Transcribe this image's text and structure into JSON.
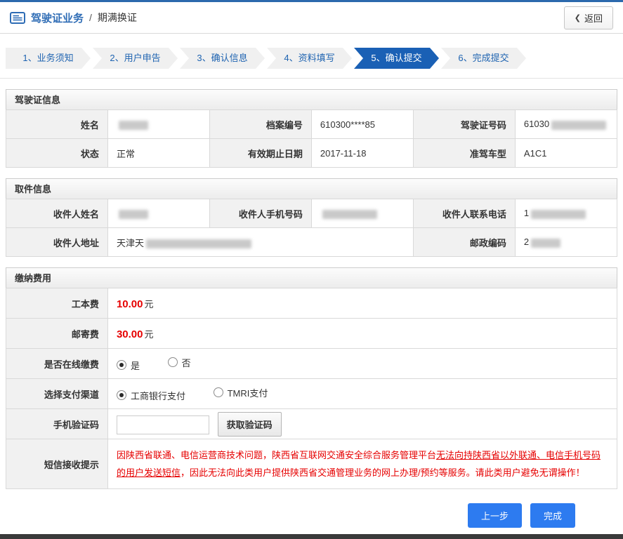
{
  "colors": {
    "accent_blue": "#2e6cb5",
    "active_step_blue": "#1a60b5",
    "alert_red": "#e60000",
    "button_blue": "#2d7bf0"
  },
  "header": {
    "title": "驾驶证业务",
    "separator": "/",
    "subtitle": "期满换证",
    "back_label": "返回"
  },
  "icons": {
    "back_chevron": "❮"
  },
  "steps": [
    {
      "label": "1、业务须知",
      "active": false
    },
    {
      "label": "2、用户申告",
      "active": false
    },
    {
      "label": "3、确认信息",
      "active": false
    },
    {
      "label": "4、资料填写",
      "active": false
    },
    {
      "label": "5、确认提交",
      "active": true
    },
    {
      "label": "6、完成提交",
      "active": false
    }
  ],
  "license_info": {
    "title": "驾驶证信息",
    "name_label": "姓名",
    "name_value": "",
    "file_no_label": "档案编号",
    "file_no_value": "610300****85",
    "license_no_label": "驾驶证号码",
    "license_no_value": "61030",
    "status_label": "状态",
    "status_value": "正常",
    "expiry_label": "有效期止日期",
    "expiry_value": "2017-11-18",
    "vehicle_class_label": "准驾车型",
    "vehicle_class_value": "A1C1"
  },
  "pickup_info": {
    "title": "取件信息",
    "recipient_name_label": "收件人姓名",
    "recipient_name_value": "",
    "recipient_mobile_label": "收件人手机号码",
    "recipient_mobile_value": "",
    "recipient_phone_label": "收件人联系电话",
    "recipient_phone_value": "1",
    "address_label": "收件人地址",
    "address_value": "天津天",
    "postcode_label": "邮政编码",
    "postcode_value": "2"
  },
  "payment": {
    "title": "缴纳费用",
    "production_fee_label": "工本费",
    "production_fee_value": "10.00",
    "mailing_fee_label": "邮寄费",
    "mailing_fee_value": "30.00",
    "fee_unit": "元",
    "online_payment_label": "是否在线缴费",
    "online_yes": "是",
    "online_no": "否",
    "channel_label": "选择支付渠道",
    "channel_icbc": "工商银行支付",
    "channel_tmri": "TMRI支付",
    "sms_code_label": "手机验证码",
    "sms_code_value": "",
    "get_code_button": "获取验证码",
    "notice_label": "短信接收提示",
    "notice_part1": "因陕西省联通、电信运营商技术问题，陕西省互联网交通安全综合服务管理平台",
    "notice_part2": "无法向持陕西省以外联通、电信手机号码的用户发送短信",
    "notice_part3": "，因此无法向此类用户提供陕西省交通管理业务的网上办理/预约等服务。请此类用户避免无谓操作！"
  },
  "actions": {
    "previous": "上一步",
    "finish": "完成"
  }
}
